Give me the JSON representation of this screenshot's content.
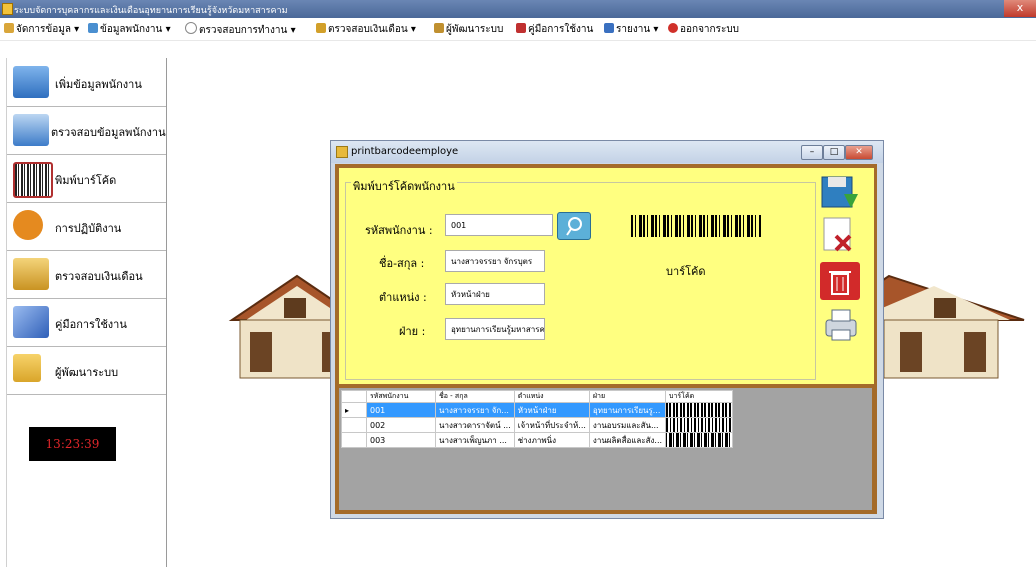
{
  "window": {
    "title": "ระบบจัดการบุคลากรและเงินเดือนอุทยานการเรียนรู้จังหวัดมหาสารคาม",
    "close": "x"
  },
  "menu": [
    {
      "label": "จัดการข้อมูล",
      "icon": "edit-icon",
      "color": "#d9a63a"
    },
    {
      "label": "ข้อมูลพนักงาน",
      "icon": "people-icon",
      "color": "#4a8fd0"
    },
    {
      "label": "ตรวจสอบการทำงาน",
      "icon": "clock-icon",
      "color": "#888888"
    },
    {
      "label": "ตรวจสอบเงินเดือน",
      "icon": "money-icon",
      "color": "#d2a02a"
    },
    {
      "label": "ผู้พัฒนาระบบ",
      "icon": "developer-icon",
      "color": "#c09030"
    },
    {
      "label": "คู่มือการใช้งาน",
      "icon": "manual-icon",
      "color": "#c03030"
    },
    {
      "label": "รายงาน",
      "icon": "report-icon",
      "color": "#3a70c0"
    },
    {
      "label": "ออกจากระบบ",
      "icon": "exit-icon",
      "color": "#d0302a"
    }
  ],
  "sidebar": [
    {
      "label": "เพิ่มข้อมูลพนักงาน",
      "icon": "add-employee-icon",
      "color": "#4b8bd4"
    },
    {
      "label": "ตรวจสอบข้อมูลพนักงาน",
      "icon": "check-employee-icon",
      "color": "#3d7cc9"
    },
    {
      "label": "พิมพ์บาร์โค้ด",
      "icon": "barcode-icon",
      "color": "#b03030"
    },
    {
      "label": "การปฏิบัติงาน",
      "icon": "calendar-icon",
      "color": "#e58a1f"
    },
    {
      "label": "ตรวจสอบเงินเดือน",
      "icon": "money-stack-icon",
      "color": "#d4a43a"
    },
    {
      "label": "คู่มือการใช้งาน",
      "icon": "book-icon",
      "color": "#3a6fc8"
    },
    {
      "label": "ผู้พัฒนาระบบ",
      "icon": "lock-icon",
      "color": "#d9a52a"
    }
  ],
  "clock": "13:23:39",
  "dialog": {
    "title": "printbarcodeemploye",
    "group_title": "พิมพ์บาร์โค้ดพนักงาน",
    "fields": {
      "code_label": "รหัสพนักงาน :",
      "code_value": "001",
      "name_label": "ชื่อ-สกุล :",
      "name_value": "นางสาวจรรยา จักรบุตร",
      "position_label": "ตำแหน่ง :",
      "position_value": "หัวหน้าฝ่าย",
      "dept_label": "ฝ่าย :",
      "dept_value": "อุทยานการเรียนรู้มหาสารคาม"
    },
    "barcode_caption": "บาร์โค้ด",
    "grid": {
      "headers": [
        "รหัสพนักงาน",
        "ชื่อ - สกุล",
        "ตำแหน่ง",
        "ฝ่าย",
        "บาร์โค้ด"
      ],
      "rows": [
        {
          "code": "001",
          "name": "นางสาวจรรยา จัก...",
          "position": "หัวหน้าฝ่าย",
          "dept": "อุทยานการเรียนรู...",
          "selected": true
        },
        {
          "code": "002",
          "name": "นางสาวดาราจัตน์ ...",
          "position": "เจ้าหน้าที่ประจำห้...",
          "dept": "งานอบรมและสัน...",
          "selected": false
        },
        {
          "code": "003",
          "name": "นางสาวเพ็ญนภา ...",
          "position": "ช่างภาพนิ่ง",
          "dept": "งานผลิตสื่อและสัง...",
          "selected": false
        }
      ]
    }
  }
}
